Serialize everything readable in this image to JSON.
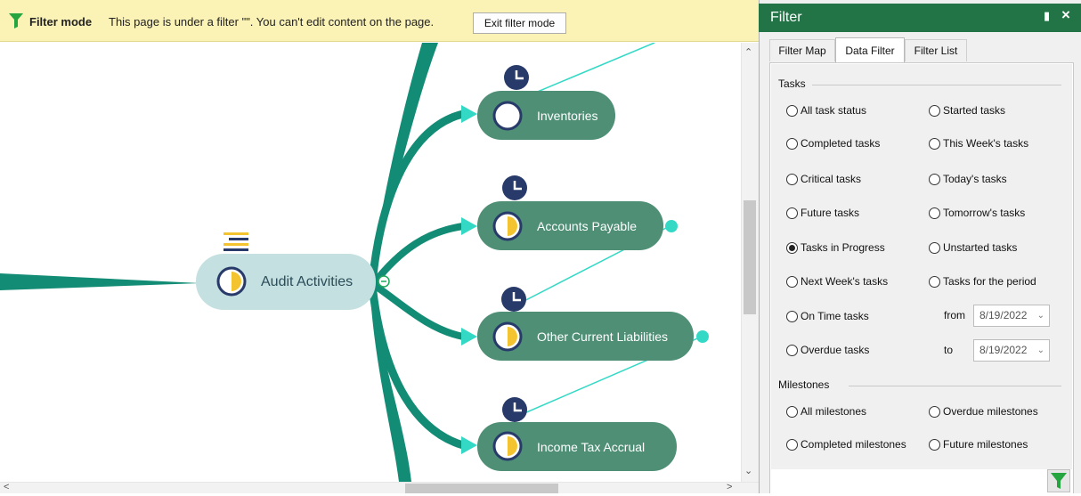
{
  "banner": {
    "title": "Filter mode",
    "message": "This page is under a filter \"\". You can't edit content on the page.",
    "exit_button": "Exit filter mode"
  },
  "mindmap": {
    "central_topic": "Audit Activities",
    "subtopics": [
      {
        "label": "Inventories"
      },
      {
        "label": "Accounts Payable"
      },
      {
        "label": "Other Current Liabilities"
      },
      {
        "label": "Income Tax  Accrual"
      }
    ]
  },
  "colors": {
    "branch": "#138c76",
    "node_fill": "#4e8f76",
    "central_fill": "#c5e0e0",
    "connector": "#34d9c6",
    "clock_navy": "#273a69",
    "progress_yellow": "#f4c430",
    "panel_header": "#227447",
    "funnel": "#25a540"
  },
  "panel": {
    "title": "Filter",
    "tabs": [
      "Filter Map",
      "Data Filter",
      "Filter List"
    ],
    "active_tab": "Data Filter",
    "tasks_section": "Tasks",
    "task_options_left": [
      "All task status",
      "Completed tasks",
      "Critical tasks",
      "Future tasks",
      "Tasks in Progress",
      "Next Week's tasks",
      "On Time tasks",
      "Overdue tasks"
    ],
    "task_options_right": [
      "Started tasks",
      "This Week's tasks",
      "Today's tasks",
      "Tomorrow's tasks",
      "Unstarted tasks",
      "Tasks for the period"
    ],
    "selected_task_option": "Tasks in Progress",
    "from_label": "from",
    "to_label": "to",
    "from_date": "8/19/2022",
    "to_date": "8/19/2022",
    "milestones_section": "Milestones",
    "milestone_options_left": [
      "All milestones",
      "Completed milestones"
    ],
    "milestone_options_right": [
      "Overdue milestones",
      "Future milestones"
    ]
  }
}
